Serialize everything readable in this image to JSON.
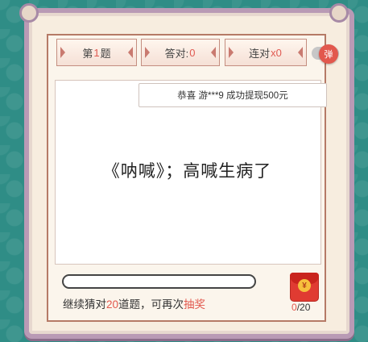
{
  "stats": {
    "question_prefix": "第",
    "question_number": "1",
    "question_suffix": "题",
    "correct_label": "答对:",
    "correct_count": "0",
    "streak_label": "连对",
    "streak_count": "x0"
  },
  "toggle": {
    "label": "弹"
  },
  "marquee": {
    "text": "恭喜 游***9 成功提现500元"
  },
  "question": {
    "text": "《呐喊》；高喊生病了"
  },
  "progress": {
    "value": 0
  },
  "hint": {
    "prefix": "继续猜对",
    "count": "20",
    "middle": "道题，可再次",
    "action": "抽奖"
  },
  "gift": {
    "icon": "red-envelope-icon",
    "coin_symbol": "¥",
    "current": "0",
    "total": "/20"
  },
  "colors": {
    "accent": "#e2584d",
    "background": "#2f8d86",
    "frame": "#b99ab5"
  }
}
